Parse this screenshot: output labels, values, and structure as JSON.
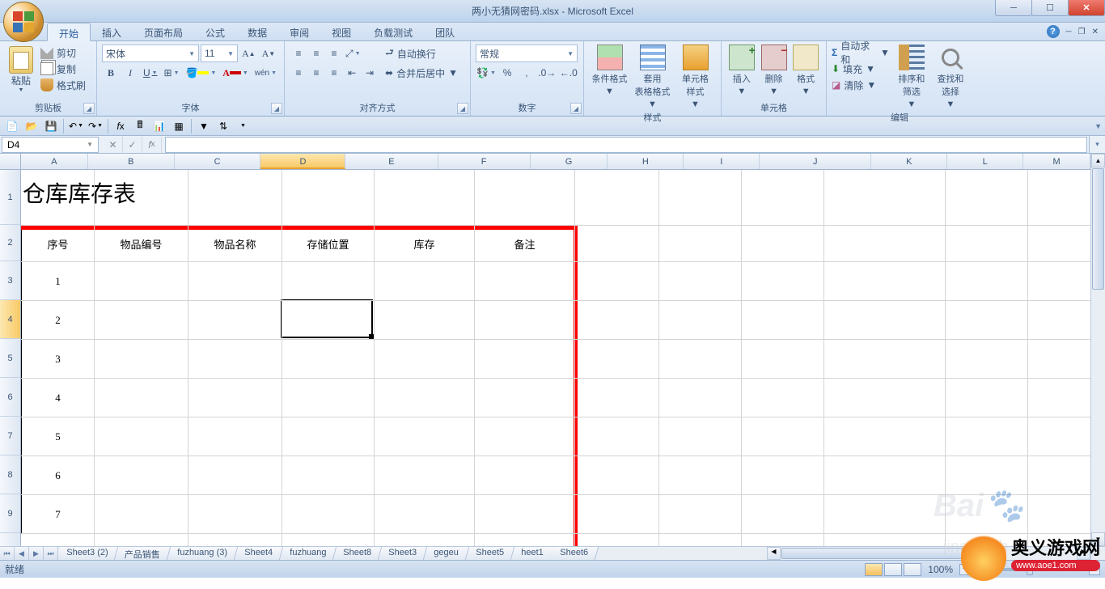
{
  "title": "两小无猜网密码.xlsx - Microsoft Excel",
  "tabs": [
    "开始",
    "插入",
    "页面布局",
    "公式",
    "数据",
    "审阅",
    "视图",
    "负载测试",
    "团队"
  ],
  "ribbon": {
    "clipboard": {
      "label": "剪贴板",
      "paste": "粘贴",
      "cut": "剪切",
      "copy": "复制",
      "brush": "格式刷"
    },
    "font": {
      "label": "字体",
      "name": "宋体",
      "size": "11",
      "b": "B",
      "i": "I",
      "u": "U"
    },
    "align": {
      "label": "对齐方式",
      "wrap": "自动换行",
      "merge": "合并后居中"
    },
    "number": {
      "label": "数字",
      "fmt": "常规"
    },
    "styles": {
      "label": "样式",
      "cond": "条件格式",
      "tfmt": "套用\n表格格式",
      "cfmt": "单元格\n样式"
    },
    "cells": {
      "label": "单元格",
      "ins": "插入",
      "del": "删除",
      "fmt": "格式"
    },
    "editing": {
      "label": "编辑",
      "sum": "自动求和",
      "fill": "填充",
      "clear": "清除",
      "sort": "排序和\n筛选",
      "find": "查找和\n选择"
    }
  },
  "name_box": "D4",
  "columns": [
    "A",
    "B",
    "C",
    "D",
    "E",
    "F",
    "G",
    "H",
    "I",
    "J",
    "K",
    "L",
    "M"
  ],
  "chart_data": {
    "type": "table",
    "title": "仓库库存表",
    "headers": [
      "序号",
      "物品编号",
      "物品名称",
      "存储位置",
      "库存",
      "备注"
    ],
    "rows": [
      [
        "1",
        "",
        "",
        "",
        "",
        ""
      ],
      [
        "2",
        "",
        "",
        "",
        "",
        ""
      ],
      [
        "3",
        "",
        "",
        "",
        "",
        ""
      ],
      [
        "4",
        "",
        "",
        "",
        "",
        ""
      ],
      [
        "5",
        "",
        "",
        "",
        "",
        ""
      ],
      [
        "6",
        "",
        "",
        "",
        "",
        ""
      ],
      [
        "7",
        "",
        "",
        "",
        "",
        ""
      ]
    ]
  },
  "sheets": [
    "Sheet3 (2)",
    "产品销售",
    "fuzhuang (3)",
    "Sheet4",
    "fuzhuang",
    "Sheet8",
    "Sheet3",
    "gegeu",
    "Sheet5",
    "heet1",
    "Sheet6"
  ],
  "status": {
    "ready": "就绪",
    "zoom": "100%"
  },
  "watermark": {
    "cn": "奥义游戏网",
    "url": "www.aoe1.com"
  }
}
